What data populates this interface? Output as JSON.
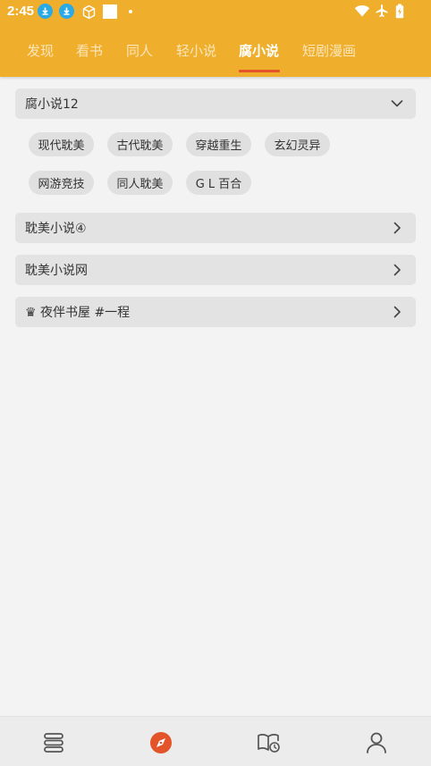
{
  "status_bar": {
    "time": "2:45",
    "icons": [
      "download-icon",
      "download-icon",
      "cube-icon",
      "square-icon",
      "dot-icon",
      "wifi-icon",
      "airplane-icon",
      "battery-icon"
    ]
  },
  "tabs": [
    {
      "label": "发现",
      "active": false
    },
    {
      "label": "看书",
      "active": false
    },
    {
      "label": "同人",
      "active": false
    },
    {
      "label": "轻小说",
      "active": false
    },
    {
      "label": "腐小说",
      "active": true
    },
    {
      "label": "短剧漫画",
      "active": false
    }
  ],
  "groups": [
    {
      "title": "腐小说12",
      "expanded": true,
      "icon": "chevron-down-icon",
      "tags": [
        "现代耽美",
        "古代耽美",
        "穿越重生",
        "玄幻灵异",
        "网游竞技",
        "同人耽美",
        "G L 百合"
      ]
    },
    {
      "title": "耽美小说④",
      "expanded": false,
      "icon": "chevron-right-icon"
    },
    {
      "title": "耽美小说网",
      "expanded": false,
      "icon": "chevron-right-icon"
    },
    {
      "title": "♛ 夜伴书屋 #一程",
      "expanded": false,
      "icon": "chevron-right-icon"
    }
  ],
  "bottom_nav": [
    {
      "icon": "bookshelf-icon",
      "active": false
    },
    {
      "icon": "compass-icon",
      "active": true
    },
    {
      "icon": "reading-history-icon",
      "active": false
    },
    {
      "icon": "profile-icon",
      "active": false
    }
  ],
  "colors": {
    "header": "#efaf2c",
    "tab_inactive": "#fbe5bb",
    "tab_active": "#ffffff",
    "indicator": "#e3542a",
    "nav_active": "#e3542a",
    "nav_inactive": "#555555",
    "background": "#f3f3f3"
  }
}
